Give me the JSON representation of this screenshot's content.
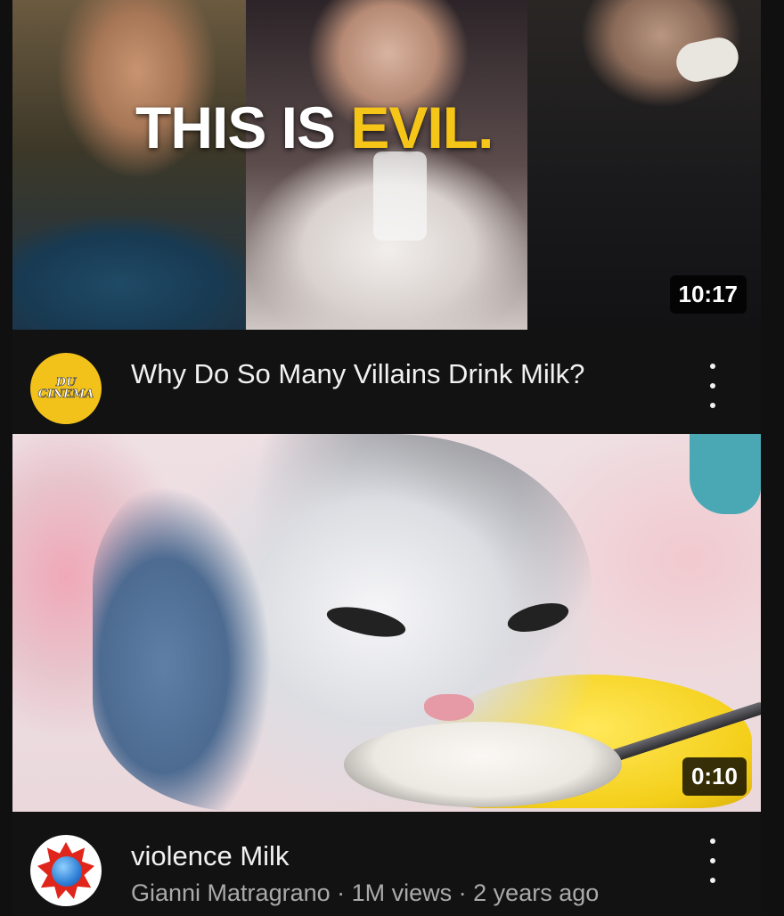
{
  "videos": [
    {
      "thumbnail_text_white": "THIS IS ",
      "thumbnail_text_yellow": "EVIL.",
      "duration": "10:17",
      "title": "Why Do So Many Villains Drink Milk?",
      "channel_avatar_line1": "DU",
      "channel_avatar_line2": "CINEMA",
      "more_icon": "vertical-ellipsis-icon"
    },
    {
      "duration": "0:10",
      "title": "violence Milk",
      "channel": "Gianni Matragrano",
      "views": "1M views",
      "age": "2 years ago",
      "separator": " · ",
      "more_icon": "vertical-ellipsis-icon"
    }
  ],
  "colors": {
    "background": "#121212",
    "headline_accent": "#f5c518",
    "secondary_text": "#aaaaaa"
  }
}
